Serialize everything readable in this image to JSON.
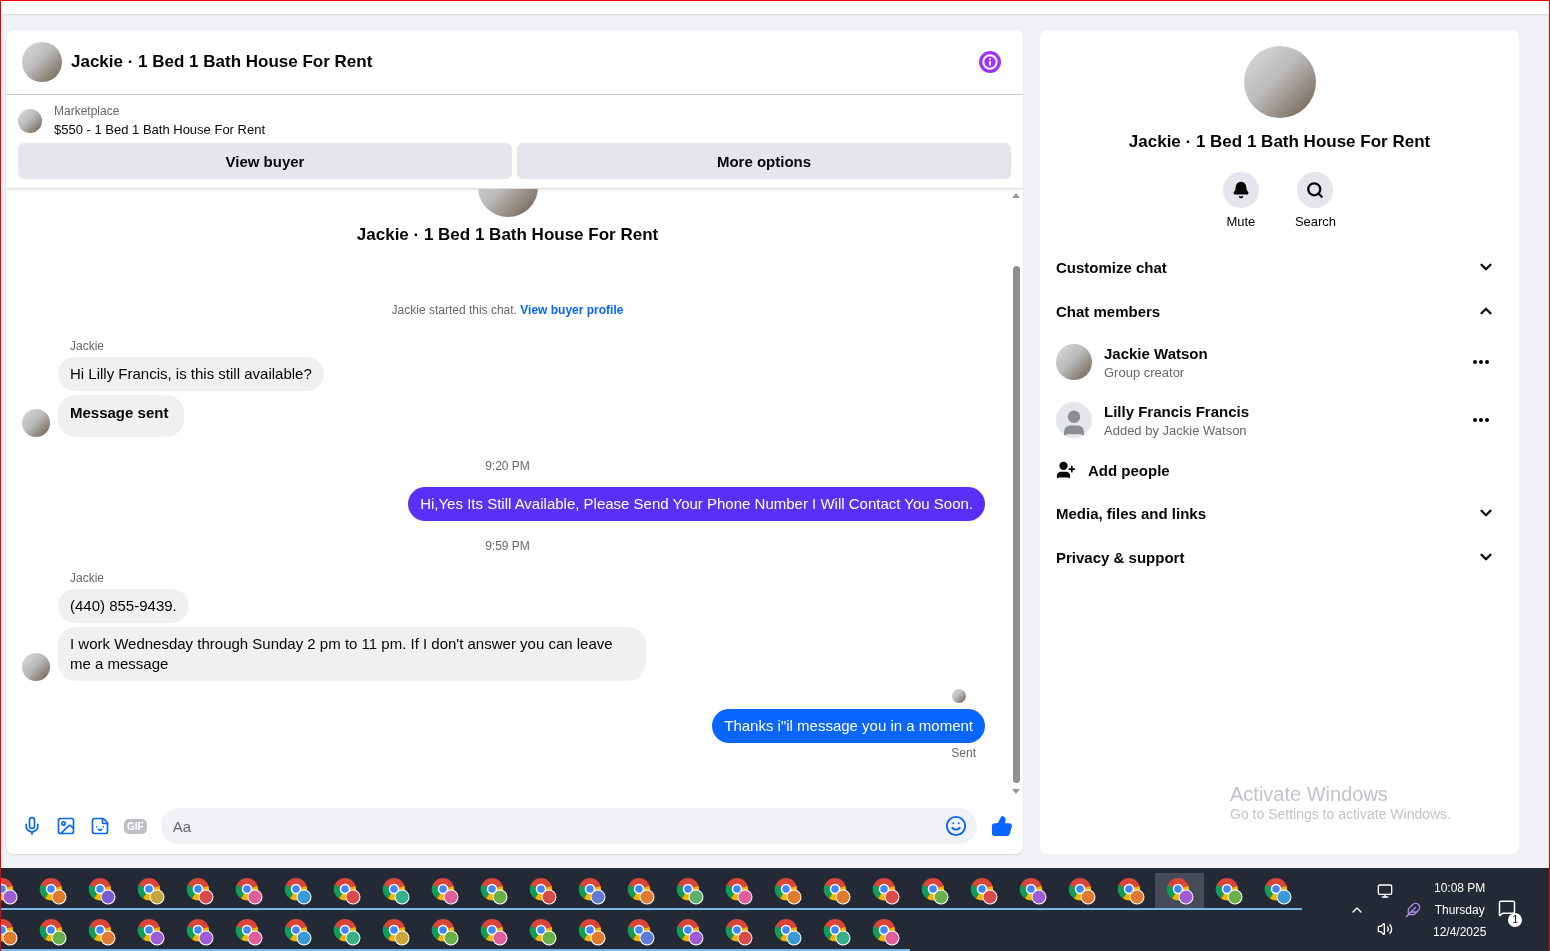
{
  "chat": {
    "title": "Jackie · 1 Bed 1 Bath House For Rent",
    "listing": {
      "source": "Marketplace",
      "summary": "$550 - 1 Bed 1 Bath House For Rent"
    },
    "buttons": [
      "View buyer",
      "More options"
    ],
    "intro_title": "Jackie · 1 Bed 1 Bath House For Rent",
    "messages": [
      {
        "kind": "system",
        "text": "Jackie started this chat.",
        "link": "View buyer profile"
      },
      {
        "kind": "sender",
        "text": "Jackie"
      },
      {
        "kind": "incoming",
        "text": "Hi Lilly Francis, is this still available?",
        "avatar": false
      },
      {
        "kind": "incoming",
        "text": "Message sent",
        "avatar": true,
        "bold": true
      },
      {
        "kind": "time",
        "text": "9:20 PM"
      },
      {
        "kind": "outgoing",
        "text": "Hi,Yes Its Still Available, Please Send Your Phone Number I Will Contact You Soon.",
        "color": "#5b2ff5"
      },
      {
        "kind": "time",
        "text": "9:59 PM"
      },
      {
        "kind": "sender",
        "text": "Jackie"
      },
      {
        "kind": "incoming",
        "text": "(440) 855-9439.",
        "avatar": false
      },
      {
        "kind": "incoming",
        "text": "I work Wednesday through Sunday 2 pm to 11 pm. If I don't answer you can leave me a message",
        "avatar": true
      },
      {
        "kind": "seen"
      },
      {
        "kind": "outgoing",
        "text": "Thanks i\"il message you in a moment",
        "color": "#0866ff"
      },
      {
        "kind": "status",
        "text": "Sent"
      }
    ],
    "composer": {
      "placeholder": "Aa",
      "gif_label": "GIF"
    }
  },
  "details": {
    "title": "Jackie · 1 Bed 1 Bath House For Rent",
    "actions": [
      {
        "kind": "mute",
        "label": "Mute"
      },
      {
        "kind": "search",
        "label": "Search"
      }
    ],
    "sections": [
      {
        "title": "Customize chat",
        "expanded": false
      },
      {
        "title": "Chat members",
        "expanded": true,
        "members": [
          {
            "name": "Jackie Watson",
            "role": "Group creator",
            "photo": true
          },
          {
            "name": "Lilly Francis Francis",
            "role": "Added by Jackie Watson",
            "photo": false
          }
        ],
        "add_label": "Add people"
      },
      {
        "title": "Media, files and links",
        "expanded": false
      },
      {
        "title": "Privacy & support",
        "expanded": false
      }
    ]
  },
  "os_watermark": {
    "title": "Activate Windows",
    "subtitle": "Go to Settings to activate Windows."
  },
  "taskbar": {
    "rows": [
      [
        {
          "color": "#a05cd6",
          "selected": false
        },
        {
          "color": "#e07a2e",
          "selected": false
        },
        {
          "color": "#7a5cd6",
          "selected": false
        },
        {
          "color": "#c8a63a",
          "selected": false
        },
        {
          "color": "#d94a4a",
          "selected": false
        },
        {
          "color": "#e05c9a",
          "selected": false
        },
        {
          "color": "#3a9ad6",
          "selected": false
        },
        {
          "color": "#d94a4a",
          "selected": false
        },
        {
          "color": "#3ab08a",
          "selected": false
        },
        {
          "color": "#e05c9a",
          "selected": false
        },
        {
          "color": "#6ab04a",
          "selected": false
        },
        {
          "color": "#d94a4a",
          "selected": false
        },
        {
          "color": "#5c7ad6",
          "selected": false
        },
        {
          "color": "#e07a2e",
          "selected": false
        },
        {
          "color": "#5cb06a",
          "selected": false
        },
        {
          "color": "#e05c9a",
          "selected": false
        },
        {
          "color": "#e07a2e",
          "selected": false
        },
        {
          "color": "#e07a2e",
          "selected": false
        },
        {
          "color": "#d94a4a",
          "selected": false
        },
        {
          "color": "#6ab04a",
          "selected": false
        },
        {
          "color": "#d94a4a",
          "selected": false
        },
        {
          "color": "#a05cd6",
          "selected": false
        },
        {
          "color": "#e07a2e",
          "selected": false
        },
        {
          "color": "#e07a2e",
          "selected": false
        },
        {
          "color": "#a05cd6",
          "selected": true
        },
        {
          "color": "#6ab04a",
          "selected": false
        },
        {
          "color": "#3a9ad6",
          "selected": false
        }
      ],
      [
        {
          "color": "#e07a2e",
          "selected": false
        },
        {
          "color": "#6ab04a",
          "selected": false
        },
        {
          "color": "#e07a2e",
          "selected": false
        },
        {
          "color": "#a05cd6",
          "selected": false
        },
        {
          "color": "#a05cd6",
          "selected": false
        },
        {
          "color": "#e05c9a",
          "selected": false
        },
        {
          "color": "#3a9ad6",
          "selected": false
        },
        {
          "color": "#3ab08a",
          "selected": false
        },
        {
          "color": "#c8a63a",
          "selected": false
        },
        {
          "color": "#6ab04a",
          "selected": false
        },
        {
          "color": "#e05c9a",
          "selected": false
        },
        {
          "color": "#6ab04a",
          "selected": false
        },
        {
          "color": "#e07a2e",
          "selected": false
        },
        {
          "color": "#5c7ad6",
          "selected": false
        },
        {
          "color": "#a05cd6",
          "selected": false
        },
        {
          "color": "#d94a4a",
          "selected": false
        },
        {
          "color": "#3a9ad6",
          "selected": false
        },
        {
          "color": "#3ab08a",
          "selected": false
        },
        {
          "color": "#e05c9a",
          "selected": false
        }
      ]
    ],
    "time": "10:08 PM",
    "day": "Thursday",
    "date": "12/4/2025",
    "notification_count": "1"
  }
}
